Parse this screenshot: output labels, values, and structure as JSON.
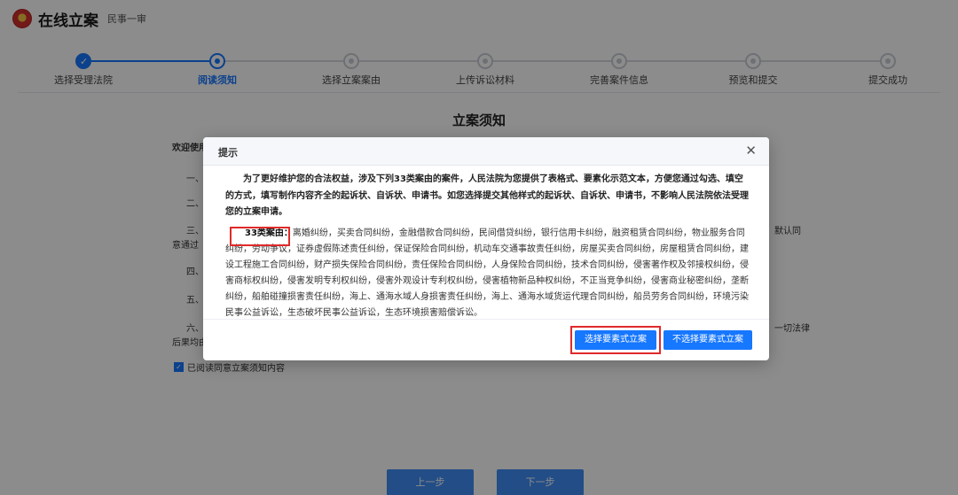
{
  "header": {
    "title": "在线立案",
    "subtitle": "民事一审"
  },
  "steps": [
    {
      "label": "选择受理法院",
      "state": "done"
    },
    {
      "label": "阅读须知",
      "state": "active"
    },
    {
      "label": "选择立案案由",
      "state": "pending"
    },
    {
      "label": "上传诉讼材料",
      "state": "pending"
    },
    {
      "label": "完善案件信息",
      "state": "pending"
    },
    {
      "label": "预览和提交",
      "state": "pending"
    },
    {
      "label": "提交成功",
      "state": "pending"
    }
  ],
  "notice": {
    "title": "立案须知",
    "fragments": [
      "欢迎使用",
      "一、",
      "二、",
      "三、",
      "默认同",
      "意通过",
      "四、",
      "五、",
      "六、",
      "一切法律",
      "后果均由"
    ],
    "agree_label": "已阅读同意立案须知内容",
    "prev_label": "上一步",
    "next_label": "下一步"
  },
  "modal": {
    "title": "提示",
    "close_icon": "close-icon",
    "intro": "为了更好维护您的合法权益，涉及下列33类案由的案件，人民法院为您提供了表格式、要素化示范文本，方便您通过勾选、填空的方式，填写制作内容齐全的起诉状、自诉状、申请书。如您选择提交其他样式的起诉状、自诉状、申请书，不影响人民法院依法受理您的立案申请。",
    "cases_label": "33类案由：",
    "cases_text": "离婚纠纷，买卖合同纠纷，金融借款合同纠纷，民间借贷纠纷，银行信用卡纠纷，融资租赁合同纠纷，物业服务合同纠纷，劳动争议，证券虚假陈述责任纠纷，保证保险合同纠纷，机动车交通事故责任纠纷，房屋买卖合同纠纷，房屋租赁合同纠纷，建设工程施工合同纠纷，财产损失保险合同纠纷，责任保险合同纠纷，人身保险合同纠纷，技术合同纠纷，侵害著作权及邻接权纠纷，侵害商标权纠纷，侵害发明专利权纠纷，侵害外观设计专利权纠纷，侵害植物新品种权纠纷，不正当竞争纠纷，侵害商业秘密纠纷，垄断纠纷，船舶碰撞损害责任纠纷，海上、通海水域人身损害责任纠纷，海上、通海水域货运代理合同纠纷，船员劳务合同纠纷，环境污染民事公益诉讼，生态破坏民事公益诉讼，生态环境损害赔偿诉讼。",
    "primary_button": "选择要素式立案",
    "secondary_button": "不选择要素式立案"
  },
  "colors": {
    "accent": "#1677ff",
    "highlight": "#e02a2a"
  }
}
